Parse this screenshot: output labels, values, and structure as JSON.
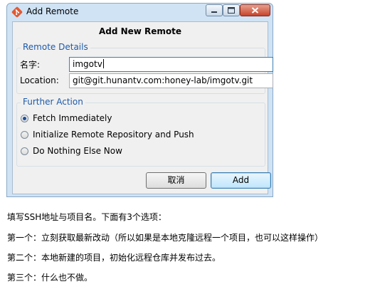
{
  "window": {
    "title": "Add Remote"
  },
  "dialog": {
    "heading": "Add New Remote",
    "remote_details": {
      "legend": "Remote Details",
      "name_label": "名字:",
      "name_value": "imgotv",
      "location_label": "Location:",
      "location_value": "git@git.hunantv.com:honey-lab/imgotv.git"
    },
    "further_action": {
      "legend": "Further Action",
      "options": [
        {
          "label": "Fetch Immediately",
          "checked": true
        },
        {
          "label": "Initialize Remote Repository and Push",
          "checked": false
        },
        {
          "label": "Do Nothing Else Now",
          "checked": false
        }
      ]
    },
    "buttons": {
      "cancel": "取消",
      "add": "Add"
    }
  },
  "description": {
    "lines": [
      "填写SSH地址与项目名。下面有3个选项：",
      "第一个：立刻获取最新改动（所以如果是本地克隆远程一个项目，也可以这样操作）",
      "第二个：本地新建的项目，初始化远程仓库并发布过去。",
      "第三个：什么也不做。"
    ]
  },
  "colors": {
    "accent": "#1e5aa8",
    "app_icon": "#e05a33"
  }
}
